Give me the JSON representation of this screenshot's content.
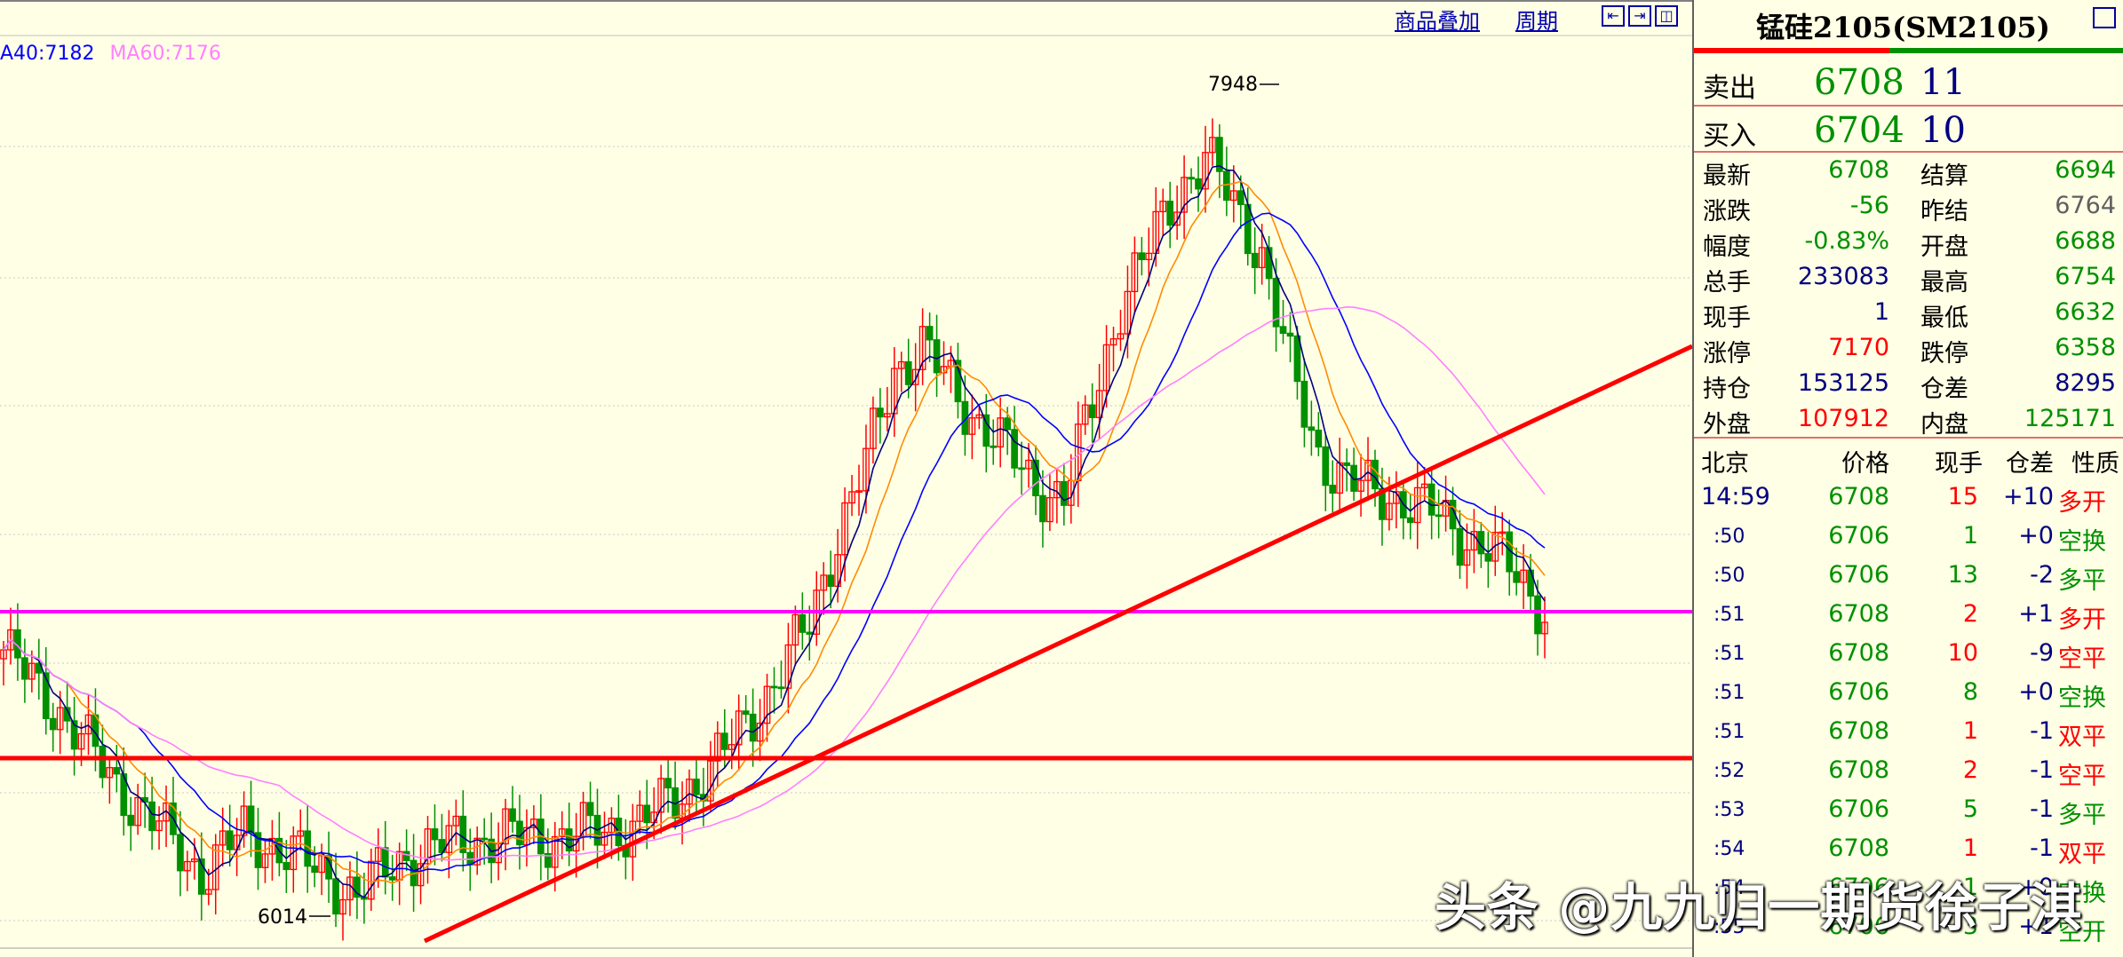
{
  "toolbar": {
    "overlay": "商品叠加",
    "period": "周期"
  },
  "ma_legend": {
    "ma40": "A40:7182",
    "ma60": "MA60:7176"
  },
  "chart_labels": {
    "high": "7948",
    "low": "6014"
  },
  "colors": {
    "up": "#FF0000",
    "down": "#009000",
    "ma5": "#000080",
    "ma10": "#FF8C00",
    "ma40": "#0000FF",
    "ma60": "#FF80FF",
    "support_magenta": "#FF00FF",
    "support_red": "#FF0000"
  },
  "panel": {
    "title": "锰硅2105(SM2105)",
    "sell": {
      "label": "卖出",
      "price": "6708",
      "vol": "11"
    },
    "buy": {
      "label": "买入",
      "price": "6704",
      "vol": "10"
    },
    "stats": [
      {
        "l1": "最新",
        "v1": "6708",
        "c1": "#009000",
        "l2": "结算",
        "v2": "6694",
        "c2": "#009000"
      },
      {
        "l1": "涨跌",
        "v1": "-56",
        "c1": "#009000",
        "l2": "昨结",
        "v2": "6764",
        "c2": "#606060"
      },
      {
        "l1": "幅度",
        "v1": "-0.83%",
        "c1": "#009000",
        "l2": "开盘",
        "v2": "6688",
        "c2": "#009000"
      },
      {
        "l1": "总手",
        "v1": "233083",
        "c1": "#000080",
        "l2": "最高",
        "v2": "6754",
        "c2": "#009000"
      },
      {
        "l1": "现手",
        "v1": "1",
        "c1": "#000080",
        "l2": "最低",
        "v2": "6632",
        "c2": "#009000"
      },
      {
        "l1": "涨停",
        "v1": "7170",
        "c1": "#FF0000",
        "l2": "跌停",
        "v2": "6358",
        "c2": "#009000"
      },
      {
        "l1": "持仓",
        "v1": "153125",
        "c1": "#000080",
        "l2": "仓差",
        "v2": "8295",
        "c2": "#000080"
      },
      {
        "l1": "外盘",
        "v1": "107912",
        "c1": "#FF0000",
        "l2": "内盘",
        "v2": "125171",
        "c2": "#009000"
      }
    ],
    "tick_header": {
      "time": "北京",
      "price": "价格",
      "vol": "现手",
      "pos": "仓差",
      "nature": "性质"
    },
    "ticks": [
      {
        "time": "14:59",
        "price": "6708",
        "vol": "15",
        "vc": "#FF0000",
        "pos": "+10",
        "nature": "多开",
        "nc": "#FF0000"
      },
      {
        "time": ":50",
        "price": "6706",
        "vol": "1",
        "vc": "#009000",
        "pos": "+0",
        "nature": "空换",
        "nc": "#009000"
      },
      {
        "time": ":50",
        "price": "6706",
        "vol": "13",
        "vc": "#009000",
        "pos": "-2",
        "nature": "多平",
        "nc": "#009000"
      },
      {
        "time": ":51",
        "price": "6708",
        "vol": "2",
        "vc": "#FF0000",
        "pos": "+1",
        "nature": "多开",
        "nc": "#FF0000"
      },
      {
        "time": ":51",
        "price": "6708",
        "vol": "10",
        "vc": "#FF0000",
        "pos": "-9",
        "nature": "空平",
        "nc": "#FF0000"
      },
      {
        "time": ":51",
        "price": "6706",
        "vol": "8",
        "vc": "#009000",
        "pos": "+0",
        "nature": "空换",
        "nc": "#009000"
      },
      {
        "time": ":51",
        "price": "6708",
        "vol": "1",
        "vc": "#FF0000",
        "pos": "-1",
        "nature": "双平",
        "nc": "#FF0000"
      },
      {
        "time": ":52",
        "price": "6708",
        "vol": "2",
        "vc": "#FF0000",
        "pos": "-1",
        "nature": "空平",
        "nc": "#FF0000"
      },
      {
        "time": ":53",
        "price": "6706",
        "vol": "5",
        "vc": "#009000",
        "pos": "-1",
        "nature": "多平",
        "nc": "#009000"
      },
      {
        "time": ":54",
        "price": "6708",
        "vol": "1",
        "vc": "#FF0000",
        "pos": "-1",
        "nature": "双平",
        "nc": "#FF0000"
      },
      {
        "time": ":54",
        "price": "6706",
        "vol": "1",
        "vc": "#009000",
        "pos": "+0",
        "nature": "空换",
        "nc": "#009000"
      },
      {
        "time": ":55",
        "price": "6706",
        "vol": "3",
        "vc": "#009000",
        "pos": "+1",
        "nature": "空开",
        "nc": "#009000"
      }
    ]
  },
  "watermark": "头条 @九九归一期货徐子淇"
}
